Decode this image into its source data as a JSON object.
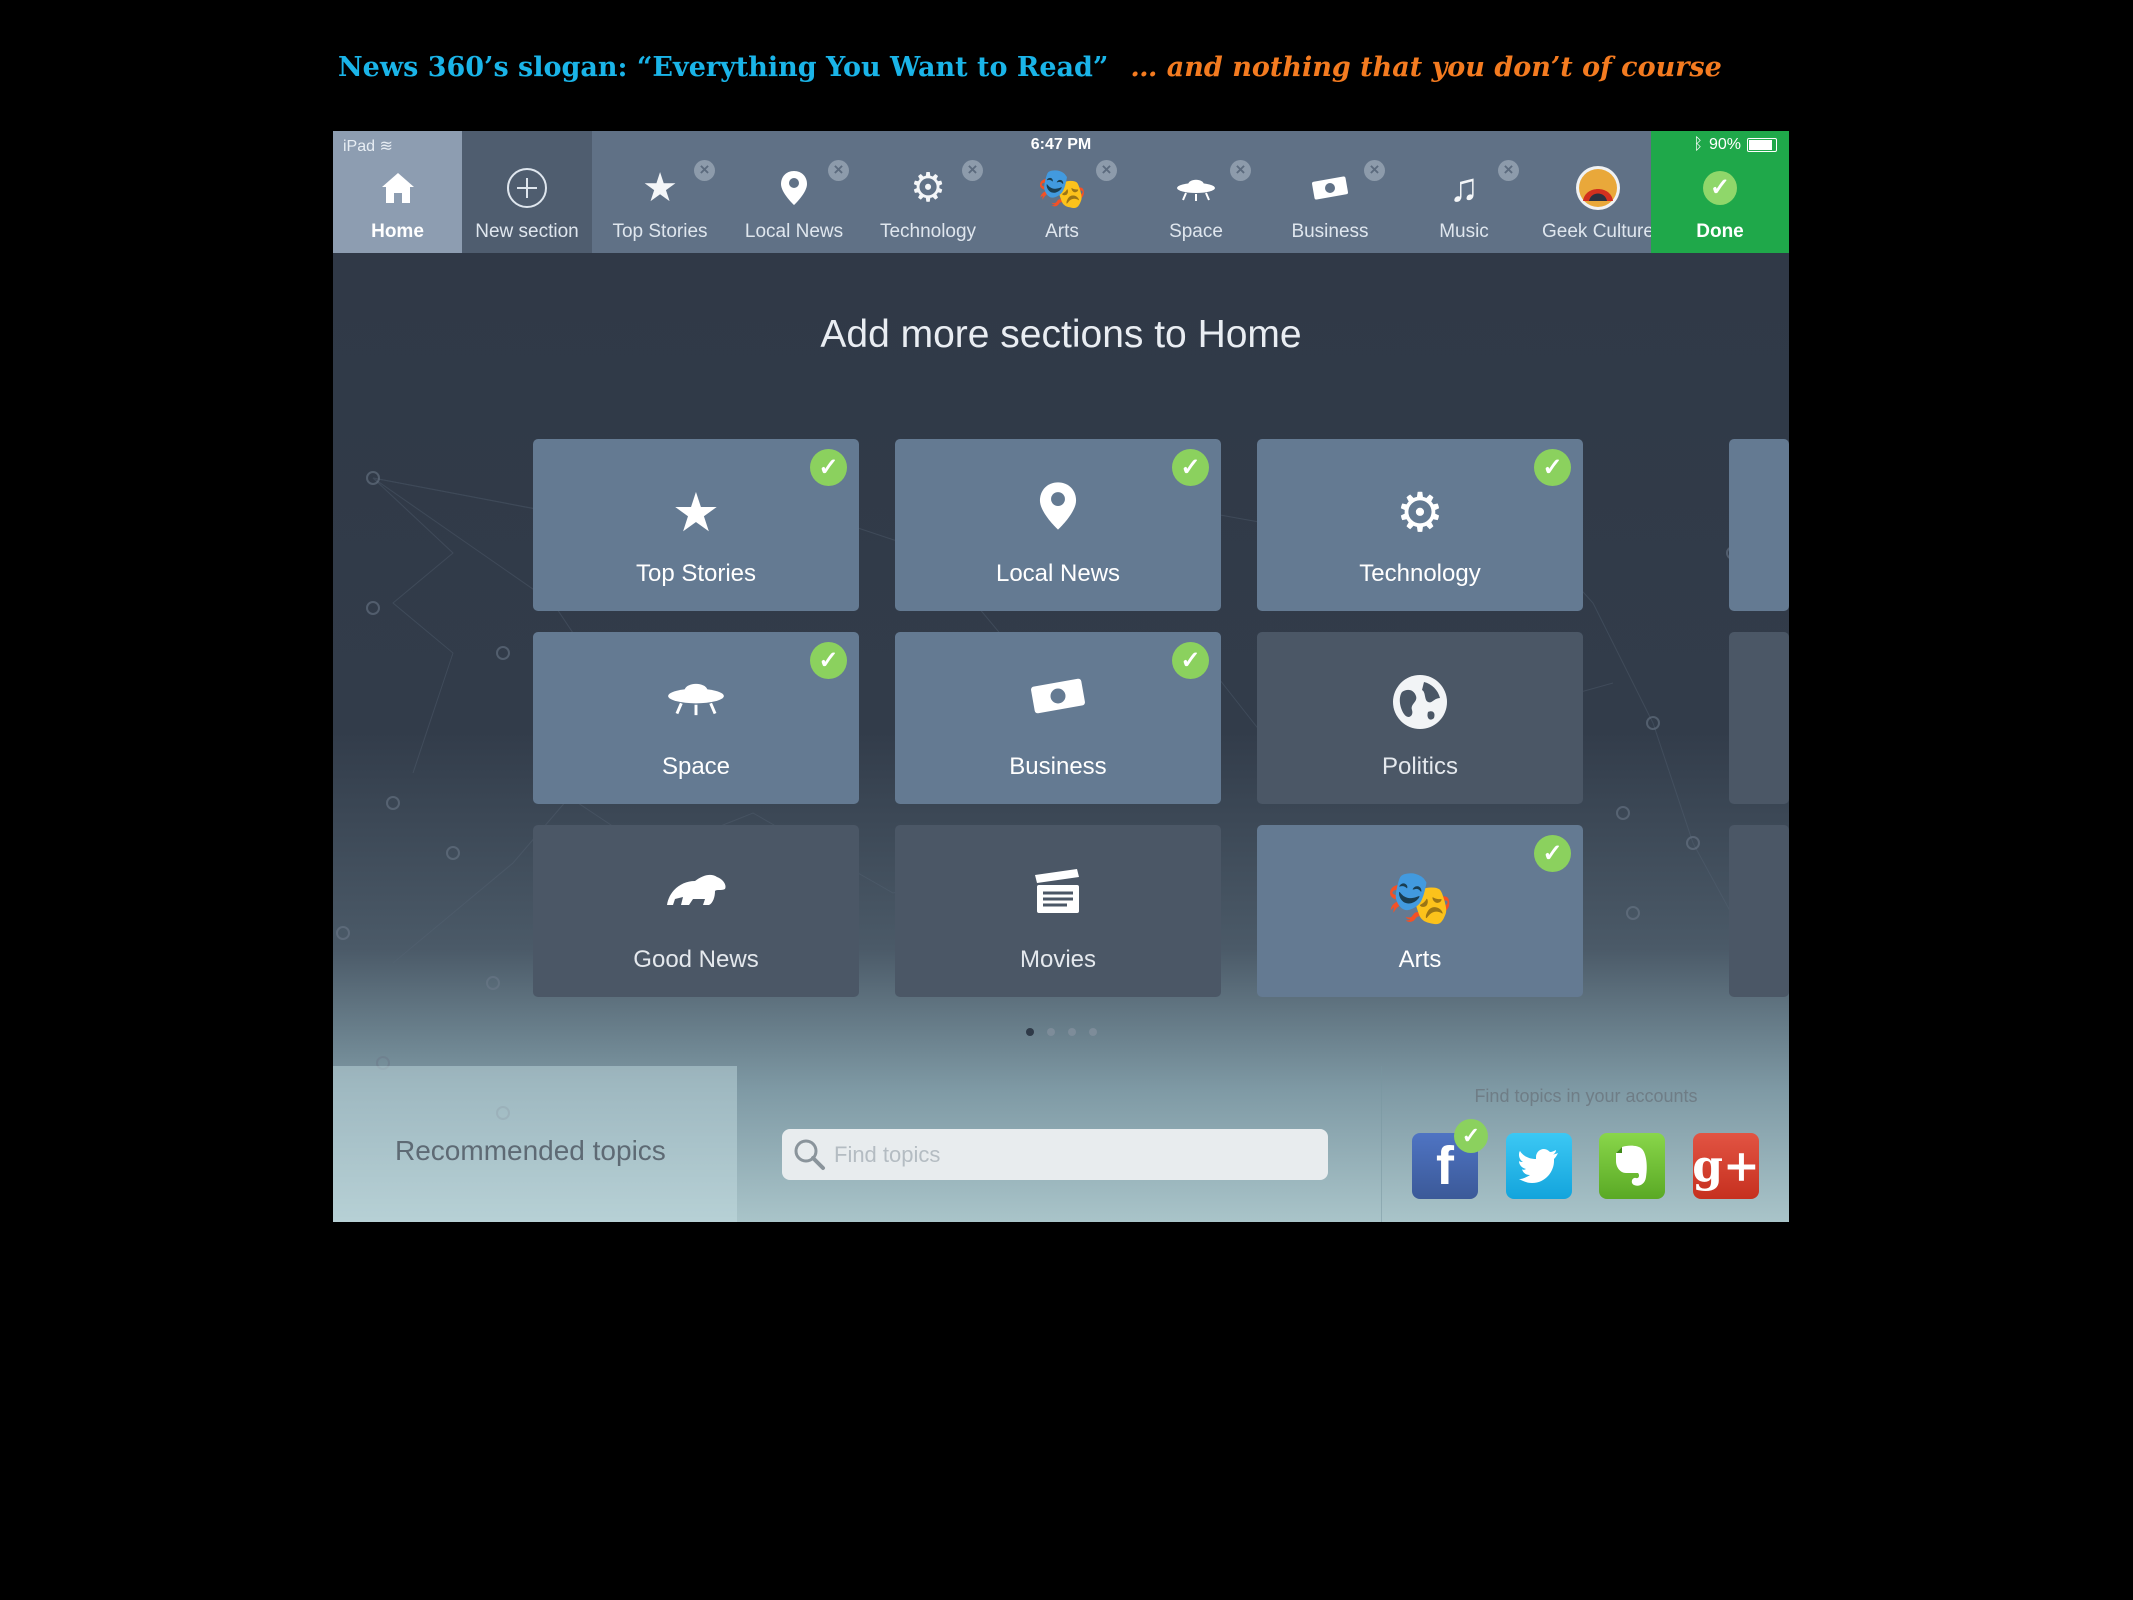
{
  "caption": {
    "slogan": "News 360’s slogan: “Everything You Want to Read”",
    "aside": "… and nothing that you don’t of course"
  },
  "status_bar": {
    "device": "iPad",
    "time": "6:47 PM",
    "battery": "90%"
  },
  "tab_bar": {
    "home": "Home",
    "new_section": "New section",
    "tabs": [
      {
        "label": "Top Stories",
        "icon": "star-icon"
      },
      {
        "label": "Local News",
        "icon": "map-pin-icon"
      },
      {
        "label": "Technology",
        "icon": "gears-icon"
      },
      {
        "label": "Arts",
        "icon": "theater-masks-icon"
      },
      {
        "label": "Space",
        "icon": "ufo-icon"
      },
      {
        "label": "Business",
        "icon": "money-icon"
      },
      {
        "label": "Music",
        "icon": "music-note-icon"
      },
      {
        "label": "Geek Culture",
        "icon": "geek-culture-avatar-icon"
      }
    ],
    "done": "Done"
  },
  "heading": "Add more sections to Home",
  "tiles": [
    {
      "label": "Top Stories",
      "selected": true
    },
    {
      "label": "Local News",
      "selected": true
    },
    {
      "label": "Technology",
      "selected": true
    },
    {
      "label": "Space",
      "selected": true
    },
    {
      "label": "Business",
      "selected": true
    },
    {
      "label": "Politics",
      "selected": false
    },
    {
      "label": "Good News",
      "selected": false
    },
    {
      "label": "Movies",
      "selected": false
    },
    {
      "label": "Arts",
      "selected": true
    }
  ],
  "pagination": {
    "pages": 4,
    "current": 1
  },
  "bottom": {
    "recommended": "Recommended topics",
    "search_placeholder": "Find topics",
    "accounts_title": "Find topics in your accounts",
    "accounts": [
      {
        "name": "facebook",
        "connected": true
      },
      {
        "name": "twitter",
        "connected": false
      },
      {
        "name": "evernote",
        "connected": false
      },
      {
        "name": "google-plus",
        "connected": false
      }
    ],
    "colors": {
      "facebook": "#3b5998",
      "twitter": "#1da1e0",
      "evernote": "#6cbf34",
      "google_plus": "#d23c2b"
    }
  },
  "colors": {
    "done_green": "#1fa84a",
    "check_green": "#8bd15e",
    "tab_bar": "#607186",
    "slogan_blue": "#1ab4e8",
    "aside_orange": "#f47b20"
  }
}
